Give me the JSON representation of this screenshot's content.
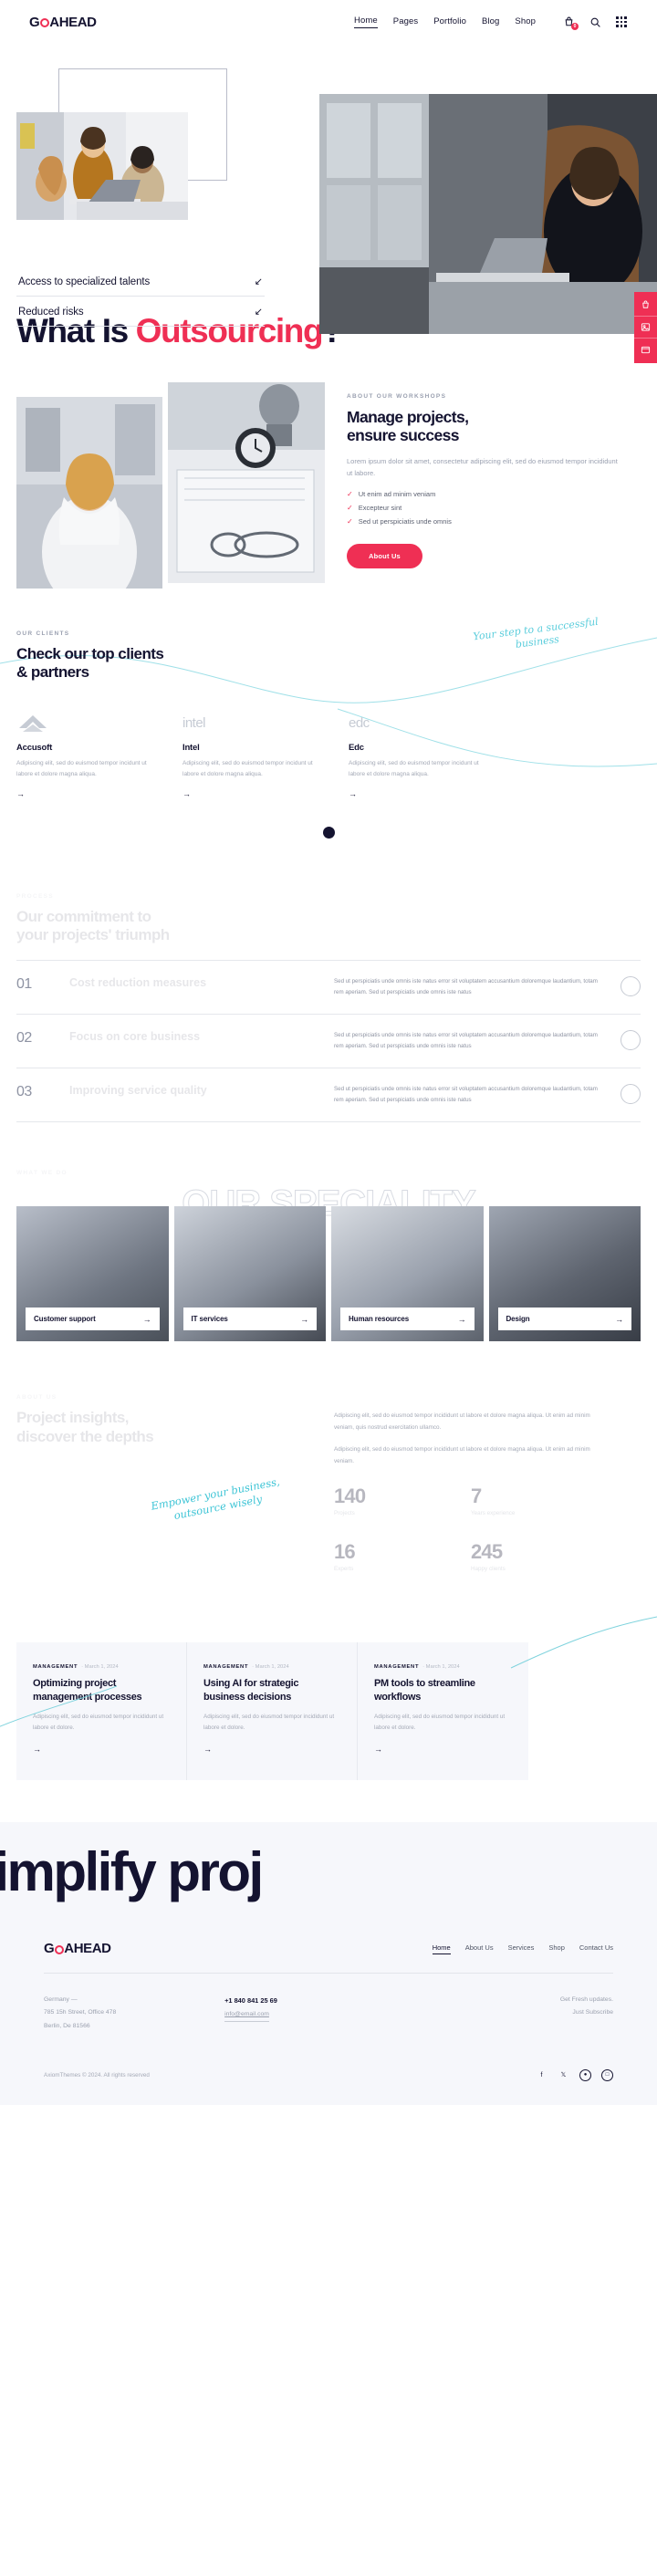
{
  "brand": {
    "name_pre": "G",
    "name_post": "AHEAD",
    "accent": "#ef2f54",
    "ink": "#141330"
  },
  "header": {
    "nav": [
      {
        "label": "Home",
        "active": true
      },
      {
        "label": "Pages",
        "active": false
      },
      {
        "label": "Portfolio",
        "active": false
      },
      {
        "label": "Blog",
        "active": false
      },
      {
        "label": "Shop",
        "active": false
      }
    ],
    "cart_count": "0",
    "icons": [
      "cart-icon",
      "search-icon",
      "grid-menu-icon"
    ]
  },
  "hero": {
    "features": [
      {
        "label": "Access to specialized talents"
      },
      {
        "label": "Reduced risks"
      }
    ]
  },
  "side_widget": {
    "items": [
      "cart-icon",
      "image-icon",
      "window-icon"
    ]
  },
  "page_title": {
    "plain": "What Is ",
    "accent": "Outsourcing",
    "tail": "?"
  },
  "workshops": {
    "eyebrow": "ABOUT OUR WORKSHOPS",
    "title_line1": "Manage projects,",
    "title_line2": "ensure success",
    "paragraph": "Lorem ipsum dolor sit amet, consectetur adipiscing elit, sed do eiusmod tempor incididunt ut labore.",
    "bullets": [
      "Ut enim ad minim veniam",
      "Excepteur sint",
      "Sed ut perspiciatis unde omnis"
    ],
    "cta": "About Us"
  },
  "clients": {
    "eyebrow": "OUR CLIENTS",
    "title_line1": "Check our top clients",
    "title_line2": "& partners",
    "script": "Your step to a successful business",
    "items": [
      {
        "logo": "accusoft-logo",
        "name": "Accusoft",
        "desc": "Adipiscing elit, sed do euismod tempor incidunt ut labore et dolore magna aliqua.",
        "arrow": "→"
      },
      {
        "logo": "intel-logo",
        "name": "Intel",
        "desc": "Adipiscing elit, sed do euismod tempor incidunt ut labore et dolore magna aliqua.",
        "arrow": "→"
      },
      {
        "logo": "edc-logo",
        "name": "Edc",
        "desc": "Adipiscing elit, sed do euismod tempor incidunt ut labore et dolore magna aliqua.",
        "arrow": "→"
      }
    ]
  },
  "commitment": {
    "eyebrow": "PROCESS",
    "title_line1": "Our commitment to",
    "title_line2": "your projects' triumph",
    "rows": [
      {
        "num": "01",
        "name": "Cost reduction measures",
        "desc": "Sed ut perspiciatis unde omnis iste natus error sit voluptatem accusantium doloremque laudantium, totam rem aperiam. Sed ut perspiciatis unde omnis iste natus"
      },
      {
        "num": "02",
        "name": "Focus on core business",
        "desc": "Sed ut perspiciatis unde omnis iste natus error sit voluptatem accusantium doloremque laudantium, totam rem aperiam. Sed ut perspiciatis unde omnis iste natus"
      },
      {
        "num": "03",
        "name": "Improving service quality",
        "desc": "Sed ut perspiciatis unde omnis iste natus error sit voluptatem accusantium doloremque laudantium, totam rem aperiam. Sed ut perspiciatis unde omnis iste natus"
      }
    ]
  },
  "speciality": {
    "eyebrow": "WHAT WE DO",
    "outline_text": "OUR SPECIALITY",
    "cards": [
      {
        "label": "Customer support",
        "arrow": "→"
      },
      {
        "label": "IT services",
        "arrow": "→"
      },
      {
        "label": "Human resources",
        "arrow": "→"
      },
      {
        "label": "Design",
        "arrow": "→"
      }
    ]
  },
  "insights": {
    "eyebrow": "ABOUT US",
    "title_line1": "Project insights,",
    "title_line2": "discover the depths",
    "script": "Empower your business, outsource wisely",
    "paragraph1": "Adipiscing elit, sed do eiusmod tempor incididunt ut labore et dolore magna aliqua. Ut enim ad minim veniam, quis nostrud exercitation ullamco.",
    "paragraph2": "Adipiscing elit, sed do eiusmod tempor incididunt ut labore et dolore magna aliqua. Ut enim ad minim veniam.",
    "stats": [
      {
        "number": "140",
        "label": "Projects"
      },
      {
        "number": "7",
        "label": "Years experience"
      },
      {
        "number": "16",
        "label": "Experts"
      },
      {
        "number": "245",
        "label": "Happy clients"
      }
    ]
  },
  "blog": {
    "cards": [
      {
        "category": "MANAGEMENT",
        "date": "March 1, 2024",
        "title": "Optimizing project management processes",
        "desc": "Adipiscing elit, sed do eiusmod tempor incididunt ut labore et dolore.",
        "arrow": "→"
      },
      {
        "category": "MANAGEMENT",
        "date": "March 1, 2024",
        "title": "Using AI for strategic business decisions",
        "desc": "Adipiscing elit, sed do eiusmod tempor incididunt ut labore et dolore.",
        "arrow": "→"
      },
      {
        "category": "MANAGEMENT",
        "date": "March 1, 2024",
        "title": "PM tools to streamline workflows",
        "desc": "Adipiscing elit, sed do eiusmod tempor incididunt ut labore et dolore.",
        "arrow": "→"
      }
    ]
  },
  "marquee": {
    "text": "nd simplify proj"
  },
  "footer": {
    "nav": [
      {
        "label": "Home",
        "active": true
      },
      {
        "label": "About Us",
        "active": false
      },
      {
        "label": "Services",
        "active": false
      },
      {
        "label": "Shop",
        "active": false
      },
      {
        "label": "Contact Us",
        "active": false
      }
    ],
    "address_line1": "Germany —",
    "address_line2": "785 15h Street, Office 478",
    "address_line3": "Berlin, De 81566",
    "phone": "+1 840 841 25 69",
    "email": "info@email.com",
    "subscribe_line1": "Get Fresh updates.",
    "subscribe_line2": "Just Subscribe",
    "copyright": "AxiomThemes © 2024. All rights reserved",
    "socials": [
      "facebook-icon",
      "x-icon",
      "dribbble-icon",
      "instagram-icon"
    ]
  }
}
